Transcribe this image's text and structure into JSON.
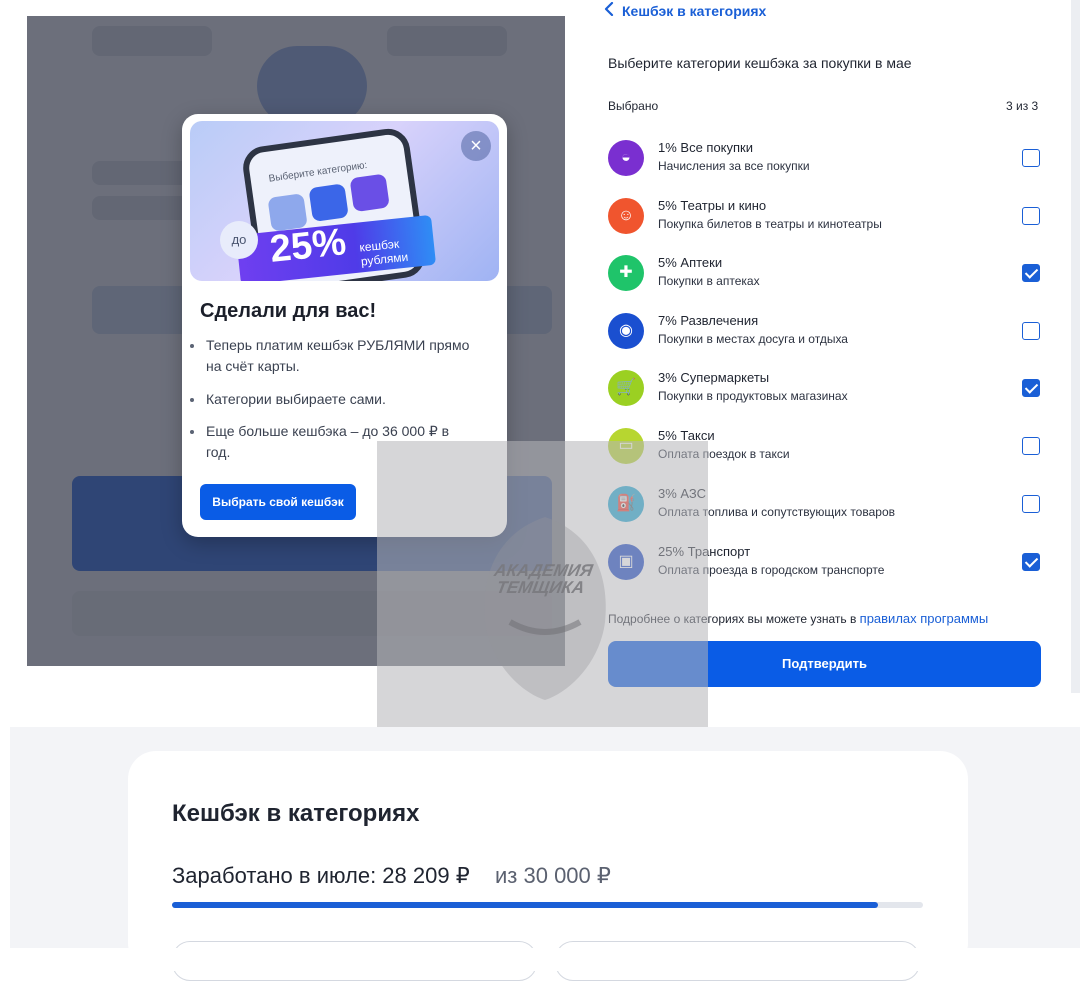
{
  "modal": {
    "banner_title": "Выберите категорию:",
    "banner_prefix": "до",
    "banner_percent": "25%",
    "banner_sub": "кешбэк рублями",
    "close_icon": "×",
    "title": "Сделали для вас!",
    "bullets": [
      "Теперь платим кешбэк РУБЛЯМИ прямо на счёт карты.",
      "Категории выбираете сами.",
      "Еще больше кешбэка – до 36 000 ₽ в год."
    ],
    "cta": "Выбрать свой кешбэк"
  },
  "panel": {
    "back_label": "Кешбэк в категориях",
    "instruction": "Выберите категории кешбэка за покупки в мае",
    "selected_label": "Выбрано",
    "selected_count": "3 из 3",
    "categories": [
      {
        "name": "1% Все покупки",
        "desc": "Начисления за все покупки",
        "checked": false,
        "color": "#7a2fd0",
        "icon": "wallet-icon",
        "glyph": "◒"
      },
      {
        "name": "5% Театры и кино",
        "desc": "Покупка билетов в театры и кинотеатры",
        "checked": false,
        "color": "#f0552e",
        "icon": "ticket-icon",
        "glyph": "☺"
      },
      {
        "name": "5% Аптеки",
        "desc": "Покупки в аптеках",
        "checked": true,
        "color": "#1fc46a",
        "icon": "pharmacy-icon",
        "glyph": "✚"
      },
      {
        "name": "7% Развлечения",
        "desc": "Покупки в местах досуга и отдыха",
        "checked": false,
        "color": "#1a4fd0",
        "icon": "gamepad-icon",
        "glyph": "◉"
      },
      {
        "name": "3% Супермаркеты",
        "desc": "Покупки в продуктовых магазинах",
        "checked": true,
        "color": "#9bd022",
        "icon": "cart-icon",
        "glyph": "🛒"
      },
      {
        "name": "5% Такси",
        "desc": "Оплата поездок в такси",
        "checked": false,
        "color": "#b7d630",
        "icon": "car-icon",
        "glyph": "▭"
      },
      {
        "name": "3% АЗС",
        "desc": "Оплата топлива и сопутствующих товаров",
        "checked": false,
        "color": "#1fa8d6",
        "icon": "fuel-icon",
        "glyph": "⛽"
      },
      {
        "name": "25% Транспорт",
        "desc": "Оплата проезда в городском транспорте",
        "checked": true,
        "color": "#1a47c8",
        "icon": "bus-icon",
        "glyph": "▣"
      }
    ],
    "rules_text": "Подробнее о категориях вы можете узнать в ",
    "rules_link": "правилах программы",
    "confirm": "Подтвердить"
  },
  "watermark": {
    "line1": "АКАДЕМИЯ",
    "line2": "ТЕМЩИКА"
  },
  "bottom": {
    "title": "Кешбэк в категориях",
    "earned_label": "Заработано в июле: 28 209 ₽",
    "earned_of": "из 30 000 ₽",
    "earned_value": 28209,
    "earned_max": 30000
  },
  "colors": {
    "accent": "#0a5ce6",
    "link": "#1a5fd6"
  }
}
